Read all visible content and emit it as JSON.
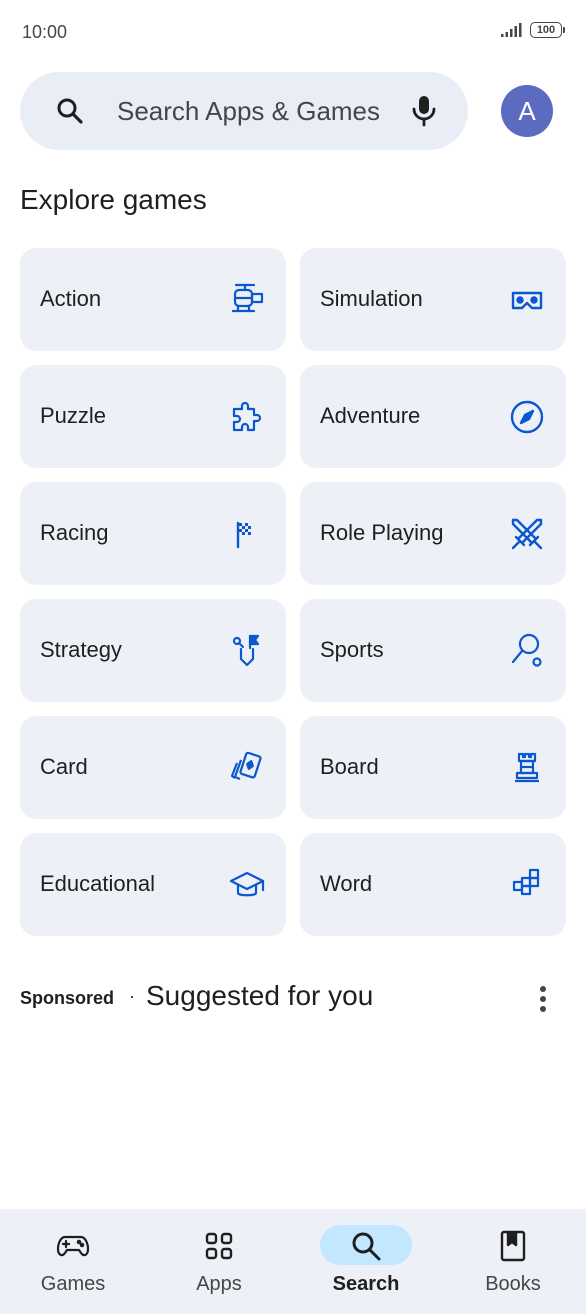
{
  "status_bar": {
    "time": "10:00",
    "battery": "100",
    "icons": [
      "signal-icon",
      "battery-icon"
    ]
  },
  "search": {
    "placeholder": "Search Apps & Games",
    "leading_icon": "search-icon",
    "trailing_icon": "mic-icon"
  },
  "account": {
    "avatar_letter": "A",
    "avatar_color": "#5c6bc0"
  },
  "explore": {
    "title": "Explore games",
    "categories": [
      {
        "label": "Action",
        "icon": "helicopter-icon"
      },
      {
        "label": "Simulation",
        "icon": "vr-headset-icon"
      },
      {
        "label": "Puzzle",
        "icon": "puzzle-piece-icon"
      },
      {
        "label": "Adventure",
        "icon": "compass-icon"
      },
      {
        "label": "Racing",
        "icon": "checkered-flag-icon"
      },
      {
        "label": "Role Playing",
        "icon": "crossed-swords-icon"
      },
      {
        "label": "Strategy",
        "icon": "strategy-icon"
      },
      {
        "label": "Sports",
        "icon": "racket-icon"
      },
      {
        "label": "Card",
        "icon": "playing-cards-icon"
      },
      {
        "label": "Board",
        "icon": "chess-rook-icon"
      },
      {
        "label": "Educational",
        "icon": "graduation-cap-icon"
      },
      {
        "label": "Word",
        "icon": "word-blocks-icon"
      }
    ]
  },
  "suggested": {
    "sponsored_label": "Sponsored",
    "separator": "·",
    "title": "Suggested for you",
    "menu_icon": "more-vert-icon"
  },
  "bottom_nav": {
    "items": [
      {
        "label": "Games",
        "icon": "gamepad-icon",
        "active": false
      },
      {
        "label": "Apps",
        "icon": "apps-grid-icon",
        "active": false
      },
      {
        "label": "Search",
        "icon": "search-icon",
        "active": true
      },
      {
        "label": "Books",
        "icon": "bookmark-book-icon",
        "active": false
      }
    ]
  },
  "colors": {
    "accent_icon": "#0b57d0",
    "tile_bg": "#edf1f7",
    "search_bg": "#e9eef6",
    "active_pill": "#c2e7ff"
  }
}
